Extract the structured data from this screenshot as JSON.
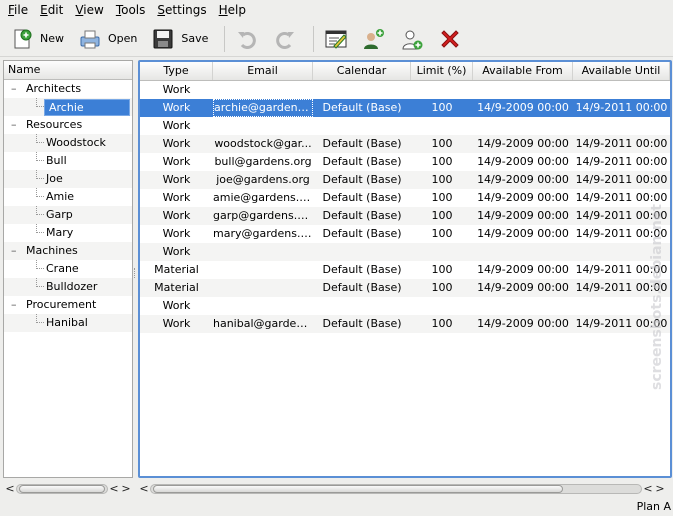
{
  "menu": [
    {
      "key": "F",
      "rest": "ile"
    },
    {
      "key": "E",
      "rest": "dit"
    },
    {
      "key": "V",
      "rest": "iew"
    },
    {
      "key": "T",
      "rest": "ools"
    },
    {
      "key": "S",
      "rest": "ettings"
    },
    {
      "key": "H",
      "rest": "elp"
    }
  ],
  "toolbar": {
    "new_label": "New",
    "open_label": "Open",
    "save_label": "Save"
  },
  "tree": {
    "header": "Name",
    "groups": [
      {
        "name": "Architects",
        "children": [
          "Archie"
        ]
      },
      {
        "name": "Resources",
        "children": [
          "Woodstock",
          "Bull",
          "Joe",
          "Amie",
          "Garp",
          "Mary"
        ]
      },
      {
        "name": "Machines",
        "children": [
          "Crane",
          "Bulldozer"
        ]
      },
      {
        "name": "Procurement",
        "children": [
          "Hanibal"
        ]
      }
    ],
    "selected": "Archie"
  },
  "table": {
    "columns": [
      "Type",
      "Email",
      "Calendar",
      "Limit (%)",
      "Available From",
      "Available Until"
    ],
    "rows": [
      [
        "Work",
        "",
        "",
        "",
        "",
        ""
      ],
      [
        "Work",
        "archie@gardens....",
        "Default (Base)",
        "100",
        "14/9-2009 00:00",
        "14/9-2011 00:00"
      ],
      [
        "Work",
        "",
        "",
        "",
        "",
        ""
      ],
      [
        "Work",
        "woodstock@gar...",
        "Default (Base)",
        "100",
        "14/9-2009 00:00",
        "14/9-2011 00:00"
      ],
      [
        "Work",
        "bull@gardens.org",
        "Default (Base)",
        "100",
        "14/9-2009 00:00",
        "14/9-2011 00:00"
      ],
      [
        "Work",
        "joe@gardens.org",
        "Default (Base)",
        "100",
        "14/9-2009 00:00",
        "14/9-2011 00:00"
      ],
      [
        "Work",
        "amie@gardens.org",
        "Default (Base)",
        "100",
        "14/9-2009 00:00",
        "14/9-2011 00:00"
      ],
      [
        "Work",
        "garp@gardens.org",
        "Default (Base)",
        "100",
        "14/9-2009 00:00",
        "14/9-2011 00:00"
      ],
      [
        "Work",
        "mary@gardens.org",
        "Default (Base)",
        "100",
        "14/9-2009 00:00",
        "14/9-2011 00:00"
      ],
      [
        "Work",
        "",
        "",
        "",
        "",
        ""
      ],
      [
        "Material",
        "",
        "Default (Base)",
        "100",
        "14/9-2009 00:00",
        "14/9-2011 00:00"
      ],
      [
        "Material",
        "",
        "Default (Base)",
        "100",
        "14/9-2009 00:00",
        "14/9-2011 00:00"
      ],
      [
        "Work",
        "",
        "",
        "",
        "",
        ""
      ],
      [
        "Work",
        "hanibal@garden...",
        "Default (Base)",
        "100",
        "14/9-2009 00:00",
        "14/9-2011 00:00"
      ]
    ],
    "selected_row": 1
  },
  "status": {
    "text": "Plan A"
  },
  "watermark": "screenshots.debian.net",
  "colors": {
    "selection": "#3c7fd6",
    "focus_border": "#5b8fd5"
  }
}
